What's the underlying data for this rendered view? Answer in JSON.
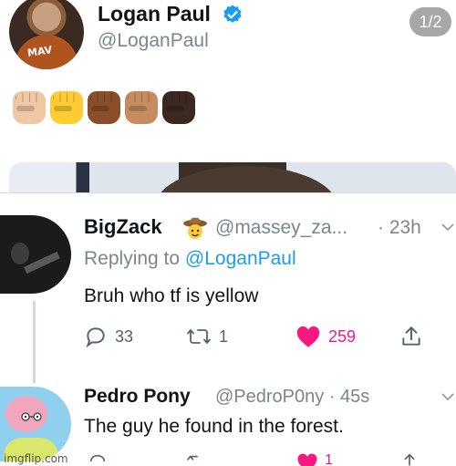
{
  "top_tweet": {
    "name": "Logan Paul",
    "handle": "@LoganPaul",
    "media_counter": "1/2",
    "avatar_shirt_text": "MAV",
    "emoji_fists": [
      "#f0c7a4",
      "#ffcc33",
      "#8a4f2a",
      "#c68b5f",
      "#3b2820"
    ]
  },
  "reply_1": {
    "name": "BigZack",
    "handle": "@massey_za...",
    "time": "· 23h",
    "replying_prefix": "Replying to",
    "replying_mention": "@LoganPaul",
    "text": "Bruh who tf is yellow",
    "replies": "33",
    "retweets": "1",
    "likes": "259"
  },
  "reply_2": {
    "name": "Pedro Pony",
    "handle": "@PedroP0ny · 45s",
    "text": "The guy he found in the forest.",
    "likes": "1"
  },
  "watermark": "imgflip.com",
  "colors": {
    "like": "#f91880",
    "link": "#1d9bf0",
    "verified": "#1d9bf0",
    "muted": "#7b858d"
  }
}
